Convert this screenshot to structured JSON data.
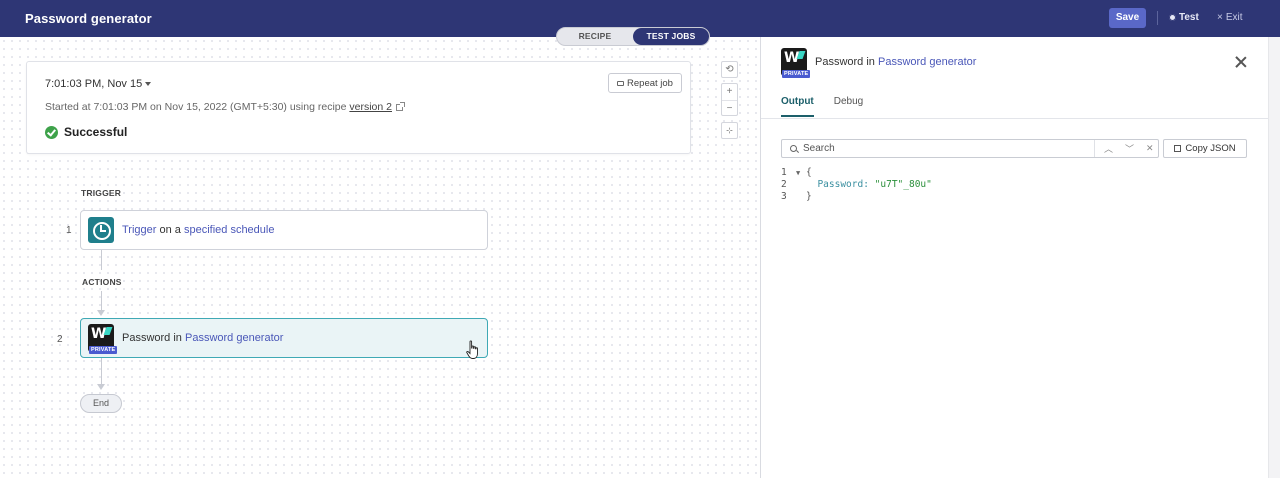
{
  "app": {
    "title": "Password generator"
  },
  "header": {
    "save_label": "Save",
    "test_label": "Test",
    "exit_label": "Exit"
  },
  "view_toggle": {
    "recipe_label": "RECIPE",
    "test_jobs_label": "TEST JOBS",
    "active": "TEST JOBS"
  },
  "job": {
    "time": "7:01:03 PM, Nov 15",
    "started_prefix": "Started at 7:01:03 PM on Nov 15, 2022 (GMT+5:30) using recipe ",
    "version_link": "version 2",
    "status": "Successful",
    "repeat_label": "Repeat job"
  },
  "zoom_controls": {
    "reset_icon": "refresh-icon",
    "zoom_in": "+",
    "zoom_out": "−",
    "fit_icon": "fit-screen-icon"
  },
  "flow": {
    "trigger_label": "TRIGGER",
    "actions_label": "ACTIONS",
    "steps": [
      {
        "number": "1",
        "icon": "clock-icon",
        "parts": [
          "Trigger",
          " on a ",
          "specified schedule"
        ]
      },
      {
        "number": "2",
        "icon": "workato-connector-icon",
        "badge": "PRIVATE",
        "parts": [
          "Password in ",
          "Password generator"
        ]
      }
    ],
    "end_label": "End"
  },
  "panel": {
    "title_prefix": "Password in ",
    "title_link": "Password generator",
    "badge": "PRIVATE",
    "tabs": [
      "Output",
      "Debug"
    ],
    "active_tab": "Output",
    "search_placeholder": "Search",
    "copy_json_label": "Copy JSON",
    "code": {
      "line_numbers": [
        "1",
        "2",
        "3"
      ],
      "open_brace": "{",
      "key": "Password: ",
      "value": "\"u7T\"_80u\"",
      "close_brace": "}"
    }
  },
  "colors": {
    "header_bg": "#2e3675",
    "save_button": "#5a68c8",
    "active_step_border": "#3fa9b5",
    "link": "#4a57b8",
    "success": "#3ea24a"
  }
}
